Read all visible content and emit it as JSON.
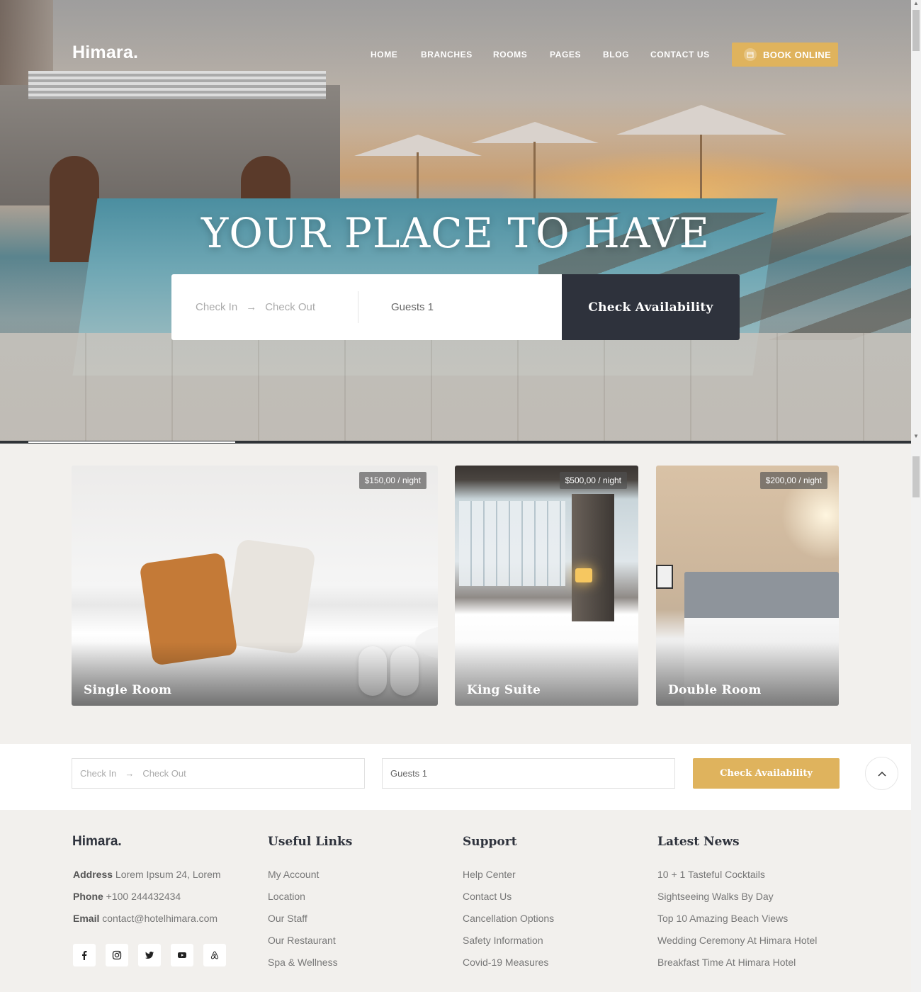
{
  "header": {
    "logo": "Himara.",
    "nav": [
      "HOME",
      "BRANCHES",
      "ROOMS",
      "PAGES",
      "BLOG",
      "CONTACT US"
    ],
    "book_button": "BOOK ONLINE"
  },
  "hero": {
    "title": "YOUR PLACE TO HAVE",
    "search": {
      "check_in": "Check In",
      "check_out": "Check Out",
      "arrow": "→",
      "guests": "Guests 1",
      "button": "Check Availability"
    }
  },
  "rooms": [
    {
      "name": "Single Room",
      "price": "$150,00 / night"
    },
    {
      "name": "King Suite",
      "price": "$500,00 / night"
    },
    {
      "name": "Double Room",
      "price": "$200,00 / night"
    }
  ],
  "booking_bar": {
    "check_in": "Check In",
    "check_out": "Check Out",
    "arrow": "→",
    "guests": "Guests 1",
    "button": "Check Availability"
  },
  "footer": {
    "logo": "Himara.",
    "contact": {
      "address_label": "Address",
      "address": "Lorem Ipsum 24, Lorem",
      "phone_label": "Phone",
      "phone": "+100 244432434",
      "email_label": "Email",
      "email": "contact@hotelhimara.com"
    },
    "social_icons": [
      "facebook-icon",
      "instagram-icon",
      "twitter-icon",
      "youtube-icon",
      "airbnb-icon"
    ],
    "useful_links": {
      "title": "Useful Links",
      "items": [
        "My Account",
        "Location",
        "Our Staff",
        "Our Restaurant",
        "Spa & Wellness"
      ]
    },
    "support": {
      "title": "Support",
      "items": [
        "Help Center",
        "Contact Us",
        "Cancellation Options",
        "Safety Information",
        "Covid-19 Measures"
      ]
    },
    "latest_news": {
      "title": "Latest News",
      "items": [
        "10 + 1 Tasteful Cocktails",
        "Sightseeing Walks By Day",
        "Top 10 Amazing Beach Views",
        "Wedding Ceremony At Himara Hotel",
        "Breakfast Time At Himara Hotel"
      ]
    }
  },
  "colors": {
    "accent": "#dfb35d",
    "dark": "#2e323c",
    "background": "#f2f0ed"
  }
}
